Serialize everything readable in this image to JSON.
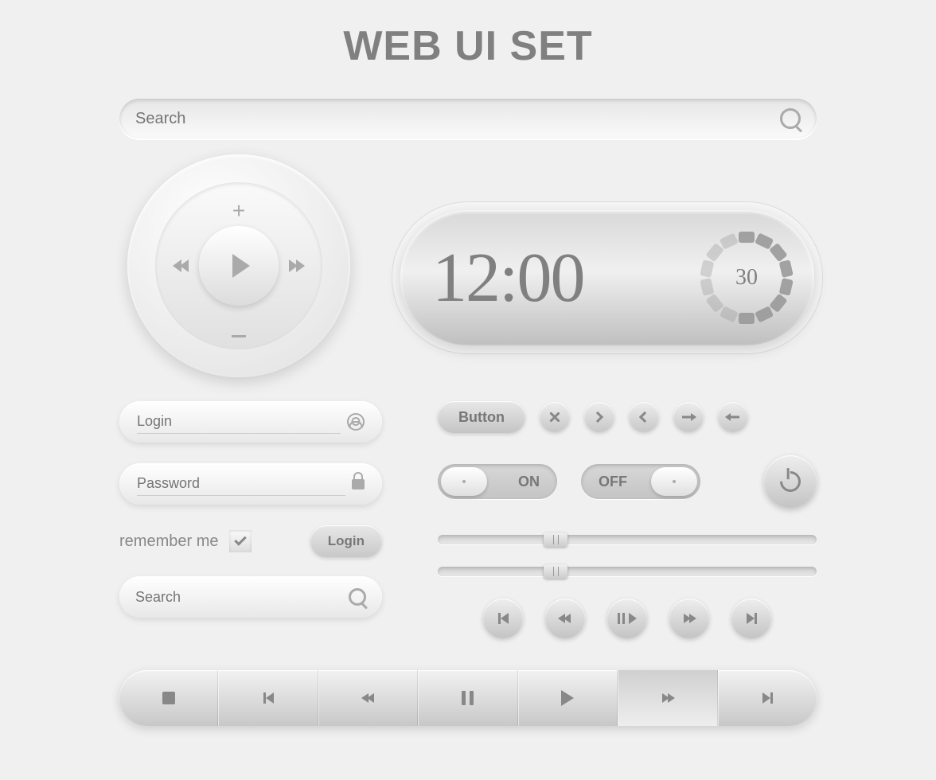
{
  "title": "WEB UI SET",
  "search_large": {
    "placeholder": "Search"
  },
  "wheel": {
    "center": "play"
  },
  "clock": {
    "time": "12:00",
    "seconds": "30"
  },
  "login_form": {
    "login_placeholder": "Login",
    "password_placeholder": "Password",
    "remember_label": "remember me",
    "submit_label": "Login"
  },
  "search_small": {
    "placeholder": "Search"
  },
  "buttons": {
    "main_label": "Button"
  },
  "toggles": {
    "on_label": "ON",
    "off_label": "OFF"
  },
  "sliders": {
    "value1": 28,
    "value2": 28
  },
  "media_controls": [
    "skip-back",
    "rewind",
    "play-pause",
    "fast-forward",
    "skip-forward"
  ],
  "player_bar": [
    "stop",
    "skip-back",
    "rewind",
    "pause",
    "play",
    "fast-forward",
    "skip-forward"
  ]
}
